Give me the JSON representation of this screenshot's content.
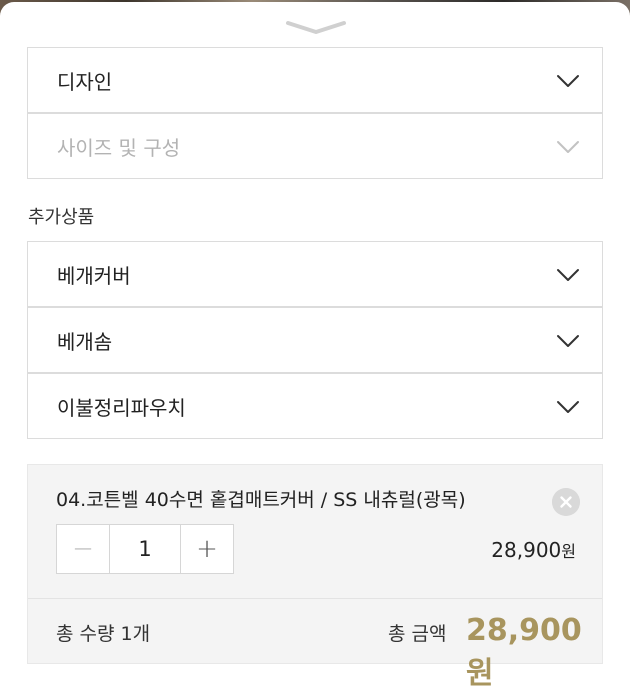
{
  "options": {
    "design_label": "디자인",
    "size_label": "사이즈 및 구성"
  },
  "addons": {
    "section_title": "추가상품",
    "items": [
      {
        "label": "베개커버"
      },
      {
        "label": "베개솜"
      },
      {
        "label": "이불정리파우치"
      }
    ]
  },
  "cart": {
    "item_name": "04.코튼벨 40수면 홑겹매트커버 / SS 내츄럴(광목)",
    "quantity": "1",
    "minus_symbol": "−",
    "plus_symbol": "+",
    "price": "28,900",
    "price_unit": "원"
  },
  "total": {
    "label": "총 수량 1개",
    "right_label": "총 금액",
    "amount": "28,900원"
  },
  "colors": {
    "accent_gold": "#a8955e",
    "border": "#dcdcdc",
    "disabled_text": "#b3b3b3"
  },
  "icons": {
    "chevron": "chevron-down-icon",
    "handle": "sheet-handle-icon",
    "remove": "close-icon"
  }
}
